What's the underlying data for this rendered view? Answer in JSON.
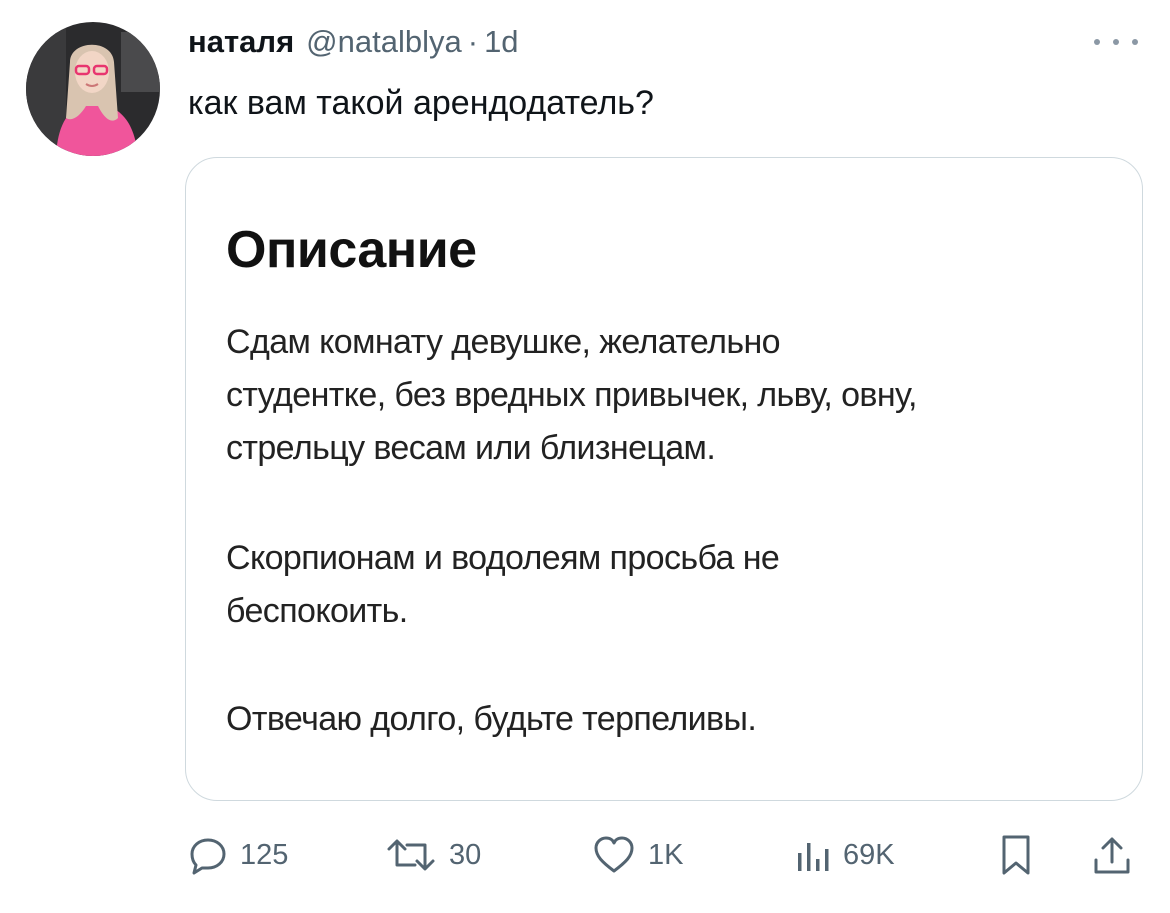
{
  "tweet": {
    "author": {
      "display_name": "наталя",
      "handle": "@natalblya",
      "avatar_icon": "profile-photo"
    },
    "separator": "·",
    "timestamp": "1d",
    "text": "как вам такой арендодатель?",
    "more_icon": "more-horizontal-icon"
  },
  "media": {
    "title": "Описание",
    "paragraphs": [
      [
        "Сдам комнату девушке, желательно",
        "студентке, без вредных привычек, льву, овну,",
        "стрельцу весам или близнецам."
      ],
      [
        "Скорпионам и водолеям просьба не",
        "беспокоить."
      ],
      [
        "Отвечаю долго, будьте терпеливы."
      ]
    ]
  },
  "actions": {
    "reply": {
      "icon": "reply-icon",
      "count": "125"
    },
    "retweet": {
      "icon": "retweet-icon",
      "count": "30"
    },
    "like": {
      "icon": "heart-icon",
      "count": "1K"
    },
    "views": {
      "icon": "views-icon",
      "count": "69K"
    },
    "bookmark": {
      "icon": "bookmark-icon"
    },
    "share": {
      "icon": "share-icon"
    }
  },
  "colors": {
    "text_primary": "#0f1419",
    "text_secondary": "#536471",
    "card_border": "#cfd9de",
    "avatar_accent": "#f0559b"
  }
}
